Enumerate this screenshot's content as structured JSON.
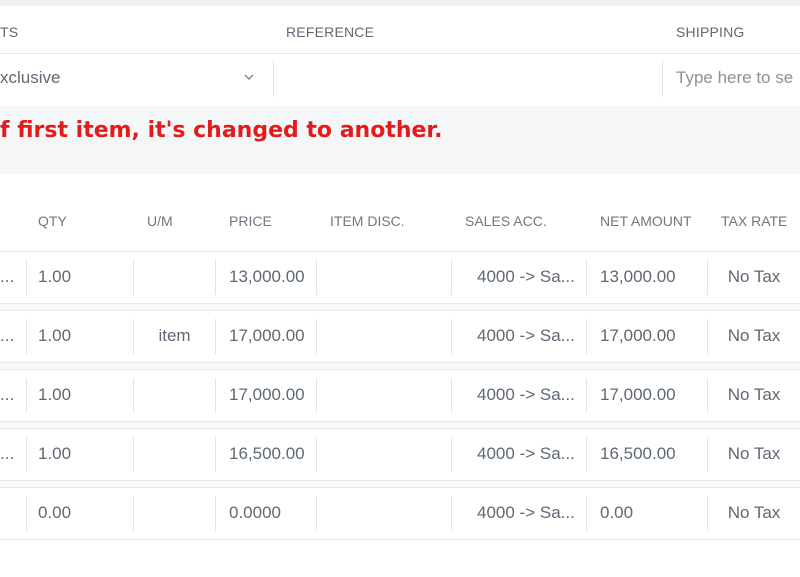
{
  "header": {
    "col_accounts": "TS",
    "col_reference": "REFERENCE",
    "col_shipping": "SHIPPING"
  },
  "fields": {
    "tax_mode_value": "xclusive",
    "reference_value": "",
    "shipping_placeholder": "Type here to se"
  },
  "annotation": {
    "text": "f first item, it's changed to another.",
    "color": "#e21c1c"
  },
  "table": {
    "columns": [
      "QTY",
      "U/M",
      "PRICE",
      "ITEM DISC.",
      "SALES ACC.",
      "NET AMOUNT",
      "TAX RATE"
    ],
    "rows": [
      {
        "lead": "...",
        "qty": "1.00",
        "um": "",
        "price": "13,000.00",
        "disc": "",
        "acc": "4000 -> Sa...",
        "net": "13,000.00",
        "tax": "No Tax"
      },
      {
        "lead": "...",
        "qty": "1.00",
        "um": "item",
        "price": "17,000.00",
        "disc": "",
        "acc": "4000 -> Sa...",
        "net": "17,000.00",
        "tax": "No Tax"
      },
      {
        "lead": "...",
        "qty": "1.00",
        "um": "",
        "price": "17,000.00",
        "disc": "",
        "acc": "4000 -> Sa...",
        "net": "17,000.00",
        "tax": "No Tax"
      },
      {
        "lead": "...",
        "qty": "1.00",
        "um": "",
        "price": "16,500.00",
        "disc": "",
        "acc": "4000 -> Sa...",
        "net": "16,500.00",
        "tax": "No Tax"
      },
      {
        "lead": "",
        "qty": "0.00",
        "um": "",
        "price": "0.0000",
        "disc": "",
        "acc": "4000 -> Sa...",
        "net": "0.00",
        "tax": "No Tax"
      }
    ]
  },
  "icons": {
    "dropdown": "chevron-down-icon"
  }
}
